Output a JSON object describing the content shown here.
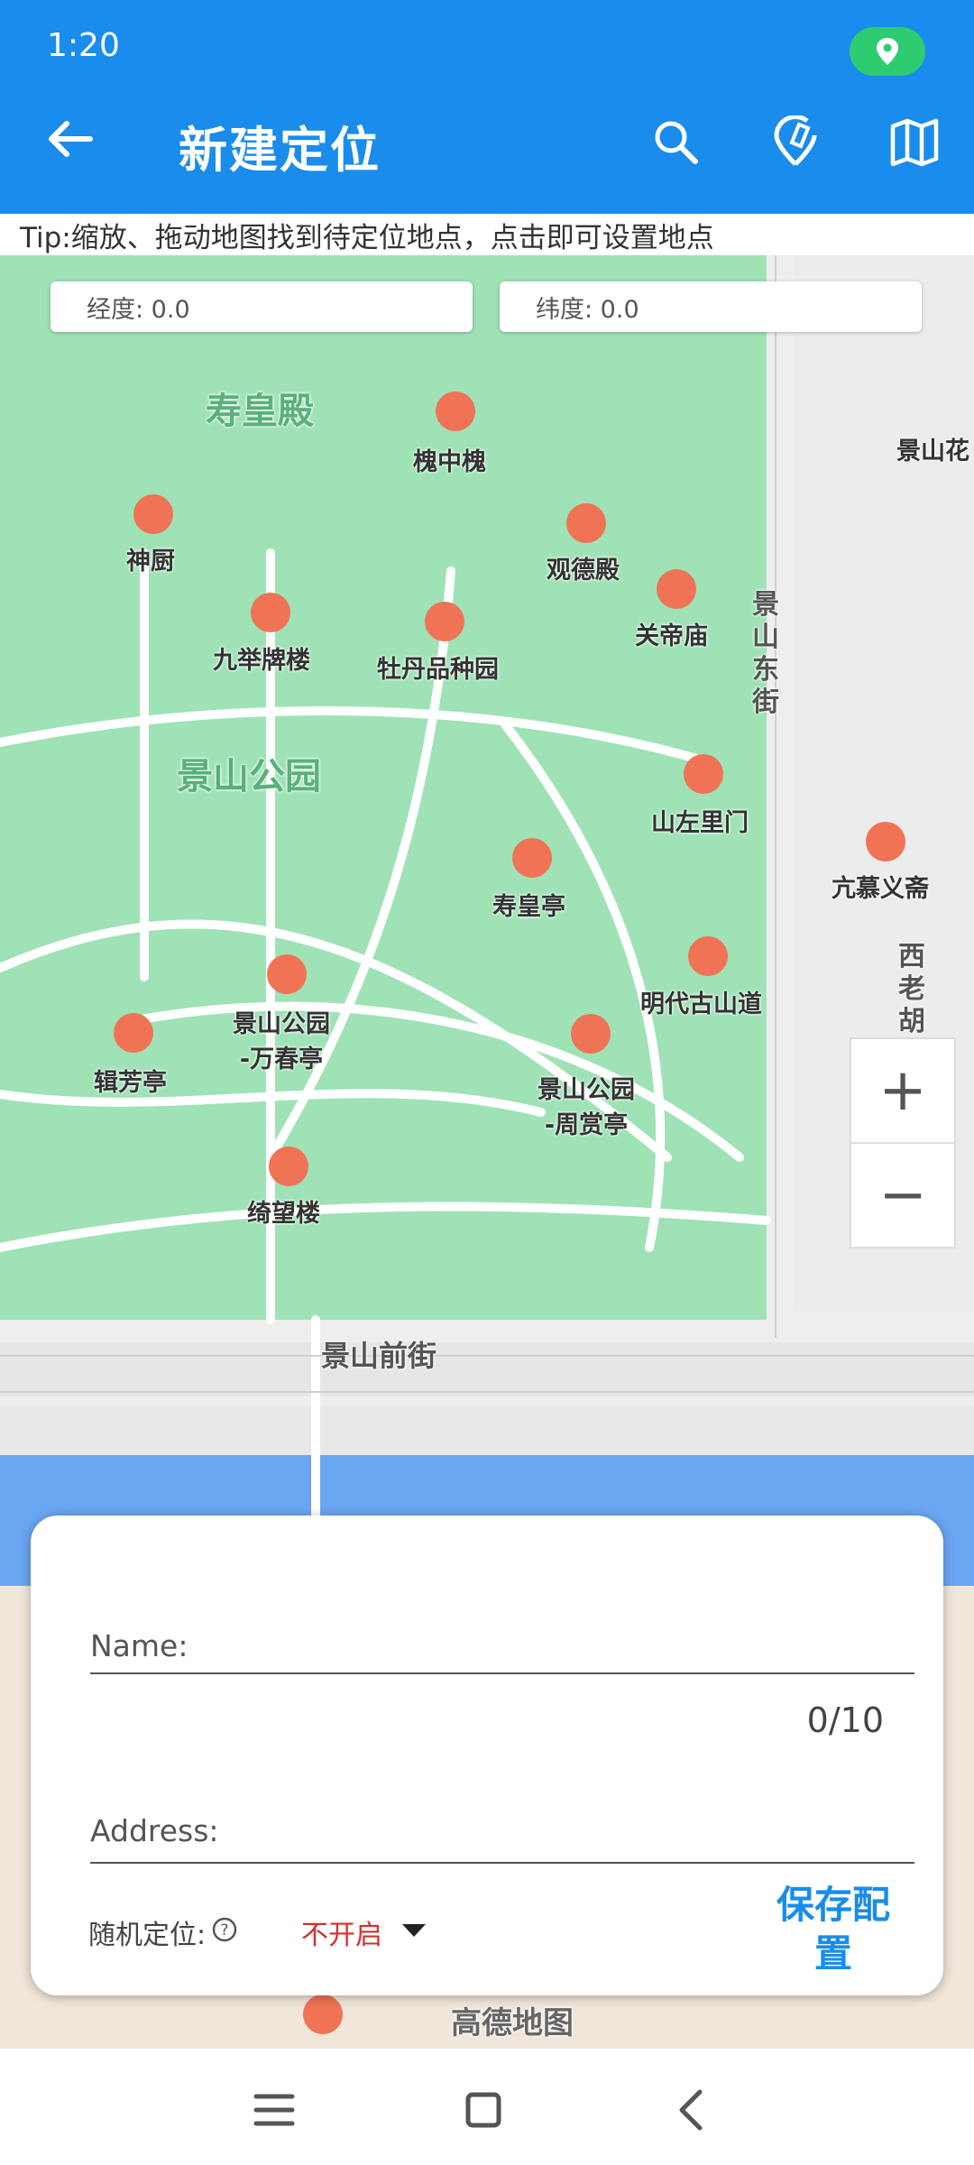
{
  "status": {
    "time": "1:20"
  },
  "appbar": {
    "title": "新建定位",
    "icons": [
      "back-arrow-icon",
      "search-icon",
      "edit-location-icon",
      "map-icon"
    ]
  },
  "tip": "Tip:缩放、拖动地图找到待定位地点，点击即可设置地点",
  "coords": {
    "lng_label": "经度: 0.0",
    "lat_label": "纬度: 0.0"
  },
  "map": {
    "pois": [
      "寿皇殿",
      "槐中槐",
      "神厨",
      "观德殿",
      "关帝庙",
      "九举牌楼",
      "牡丹品种园",
      "景山公园",
      "山左里门",
      "寿皇亭",
      "明代古山道",
      "景山公园\n-万春亭",
      "辑芳亭",
      "景山公园\n-周赏亭",
      "绮望楼",
      "景山前街",
      "景山东街",
      "亢慕义斋",
      "西老胡同",
      "景山花",
      "高德地图"
    ],
    "zoom_in": "+",
    "zoom_out": "−"
  },
  "form": {
    "name_label": "Name:",
    "name_value": "",
    "counter": "0/10",
    "address_label": "Address:",
    "address_value": "",
    "random_label": "随机定位:",
    "random_value": "不开启",
    "save_label": "保存配置"
  },
  "colors": {
    "primary": "#1a8ceb",
    "park": "#9fe2b6",
    "water": "#6aa6f2"
  }
}
